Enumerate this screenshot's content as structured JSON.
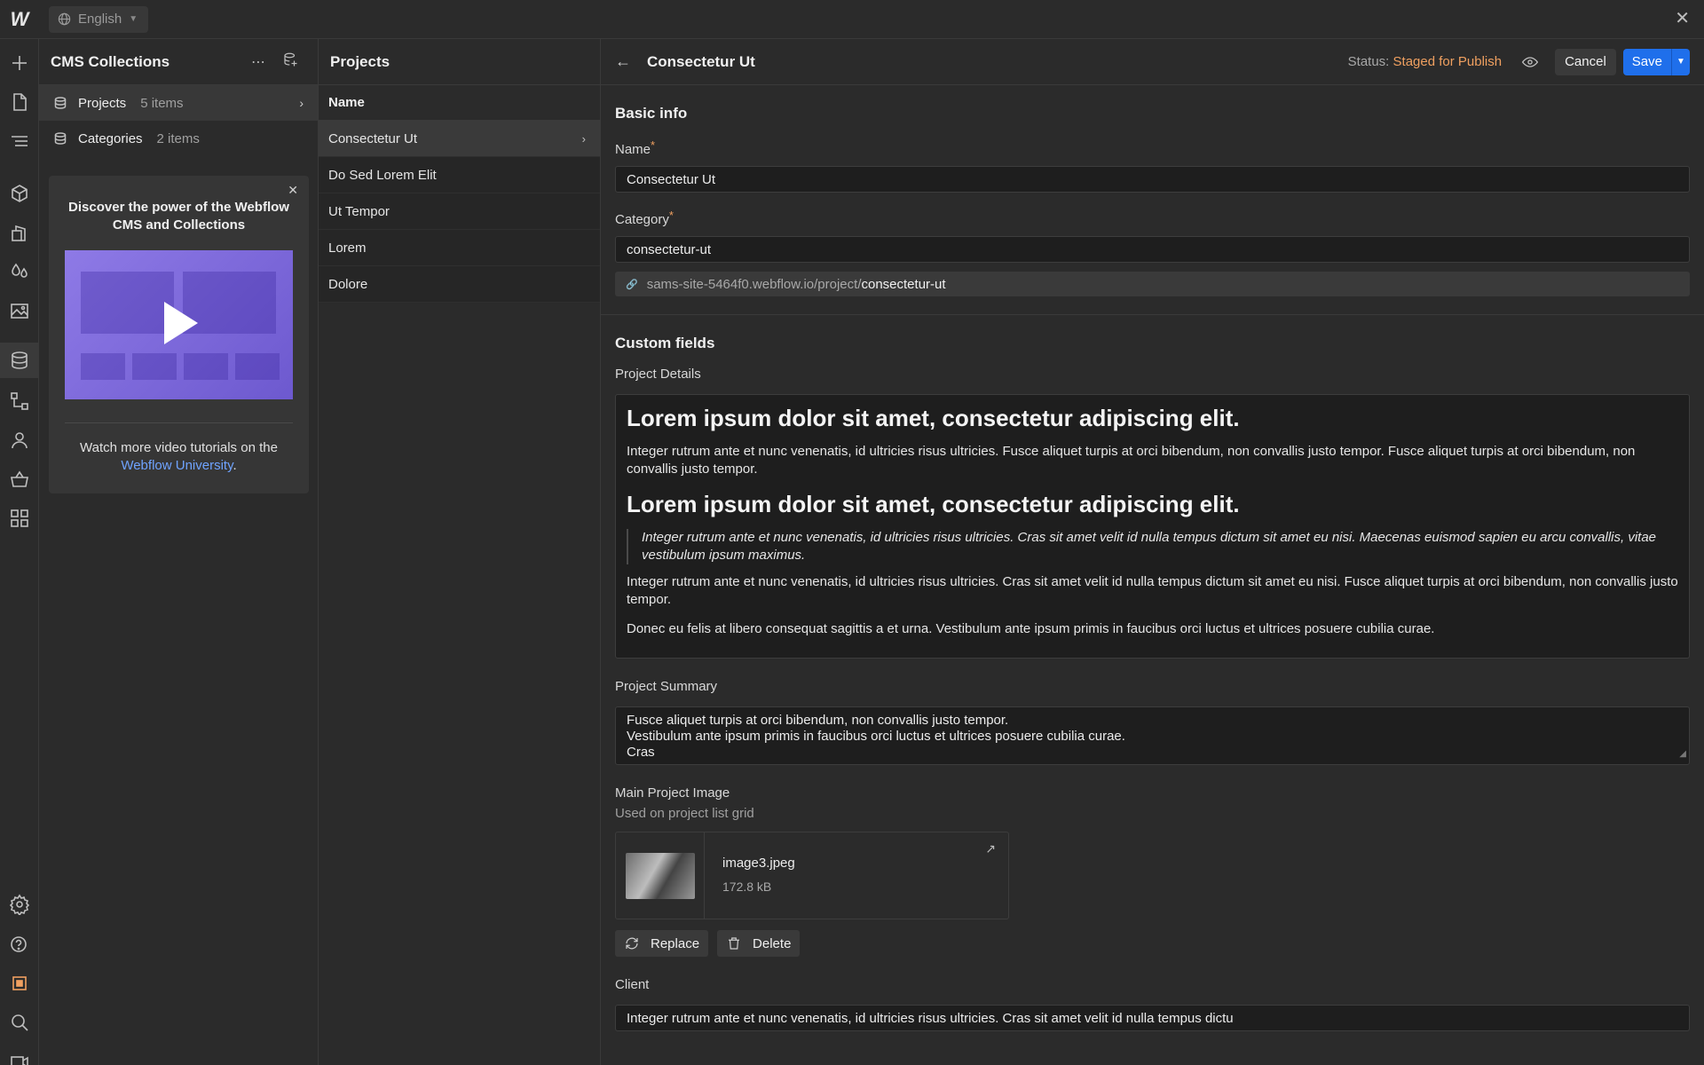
{
  "topbar": {
    "logo": "W",
    "language": "English",
    "close_icon": "✕"
  },
  "rail": {
    "icons": [
      "add-icon",
      "pages-icon",
      "navigator-icon",
      "components-icon",
      "styles-icon",
      "variables-icon",
      "assets-icon",
      "cms-icon",
      "logic-icon",
      "users-icon",
      "ecommerce-icon",
      "apps-icon",
      "settings-icon",
      "help-icon",
      "audit-icon",
      "search-icon",
      "video-icon"
    ]
  },
  "collections": {
    "title": "CMS Collections",
    "more_icon": "⋯",
    "items": [
      {
        "name": "Projects",
        "count": "5 items"
      },
      {
        "name": "Categories",
        "count": "2 items"
      }
    ],
    "promo": {
      "title": "Discover the power of the Webflow CMS and Collections",
      "text_before": "Watch more video tutorials on the",
      "link": "Webflow University",
      "text_after": "."
    }
  },
  "items_panel": {
    "title": "Projects",
    "column": "Name",
    "rows": [
      "Consectetur Ut",
      "Do Sed Lorem Elit",
      "Ut Tempor",
      "Lorem",
      "Dolore"
    ]
  },
  "editor": {
    "title": "Consectetur Ut",
    "status_label": "Status:",
    "status_value": "Staged for Publish",
    "cancel": "Cancel",
    "save": "Save",
    "basic_info": {
      "heading": "Basic info",
      "name_label": "Name",
      "name_value": "Consectetur Ut",
      "category_label": "Category",
      "category_value": "consectetur-ut",
      "slug_prefix": "sams-site-5464f0.webflow.io/project/",
      "slug_value": "consectetur-ut"
    },
    "custom_fields": {
      "heading": "Custom fields",
      "details_label": "Project Details",
      "details": {
        "h1": "Lorem ipsum dolor sit amet, consectetur adipiscing elit.",
        "p1": "Integer rutrum ante et nunc venenatis, id ultricies risus ultricies. Fusce aliquet turpis at orci bibendum, non convallis justo tempor. Fusce aliquet turpis at orci bibendum, non convallis justo tempor.",
        "h2": "Lorem ipsum dolor sit amet, consectetur adipiscing elit.",
        "quote": "Integer rutrum ante et nunc venenatis, id ultricies risus ultricies. Cras sit amet velit id nulla tempus dictum sit amet eu nisi. Maecenas euismod sapien eu arcu convallis, vitae vestibulum ipsum maximus.",
        "p2": "Integer rutrum ante et nunc venenatis, id ultricies risus ultricies. Cras sit amet velit id nulla tempus dictum sit amet eu nisi. Fusce aliquet turpis at orci bibendum, non convallis justo tempor.",
        "p3": "Donec eu felis at libero consequat sagittis a et urna. Vestibulum ante ipsum primis in faucibus orci luctus et ultrices posuere cubilia curae."
      },
      "summary_label": "Project Summary",
      "summary_lines": [
        "Fusce aliquet turpis at orci bibendum, non convallis justo tempor.",
        "Vestibulum ante ipsum primis in faucibus orci luctus et ultrices posuere cubilia curae.",
        "Cras"
      ],
      "image_label": "Main Project Image",
      "image_hint": "Used on project list grid",
      "image_file": "image3.jpeg",
      "image_size": "172.8 kB",
      "replace": "Replace",
      "delete": "Delete",
      "client_label": "Client",
      "client_value": "Integer rutrum ante et nunc venenatis, id ultricies risus ultricies. Cras sit amet velit id nulla tempus dictu"
    }
  }
}
